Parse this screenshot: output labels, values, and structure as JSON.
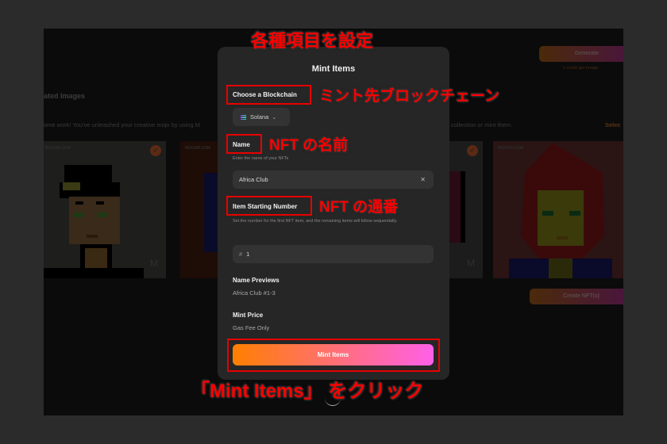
{
  "background_app": {
    "section_title": "ated Images",
    "description_left": "ome work! You've unleashed your creative mojo by using M",
    "description_right": "collection or mint them.",
    "select_link": "Selec",
    "generate_button": "Generate",
    "credit_note": "1 credit per image",
    "watermark": "MOOAR.COM",
    "create_button": "Create NFT(s)",
    "logo_label": "MOOAR"
  },
  "modal": {
    "title": "Mint Items",
    "blockchain": {
      "label": "Choose a Blockchain",
      "selected": "Solana",
      "icon": "solana-logo-icon"
    },
    "name": {
      "label": "Name",
      "help": "Enter the name of your NFTs",
      "value": "Africa Club",
      "clear_icon": "close-icon"
    },
    "start_number": {
      "label": "Item Starting Number",
      "help": "Set the number for the first NFT item, and the remaining items will follow sequentially.",
      "prefix": "#",
      "value": "1"
    },
    "name_previews": {
      "label": "Name Previews",
      "value": "Africa Club #1-3"
    },
    "mint_price": {
      "label": "Mint Price",
      "value": "Gas Fee Only"
    },
    "mint_button": "Mint Items"
  },
  "annotations": {
    "top": "各種項目を設定",
    "blockchain": "ミント先ブロックチェーン",
    "name": "NFT の名前",
    "number": "NFT の通番",
    "bottom": "「Mint Items」 をクリック"
  },
  "colors": {
    "annotation": "#ff0000",
    "gradient_start": "#ff7f00",
    "gradient_end": "#ff60e8"
  }
}
